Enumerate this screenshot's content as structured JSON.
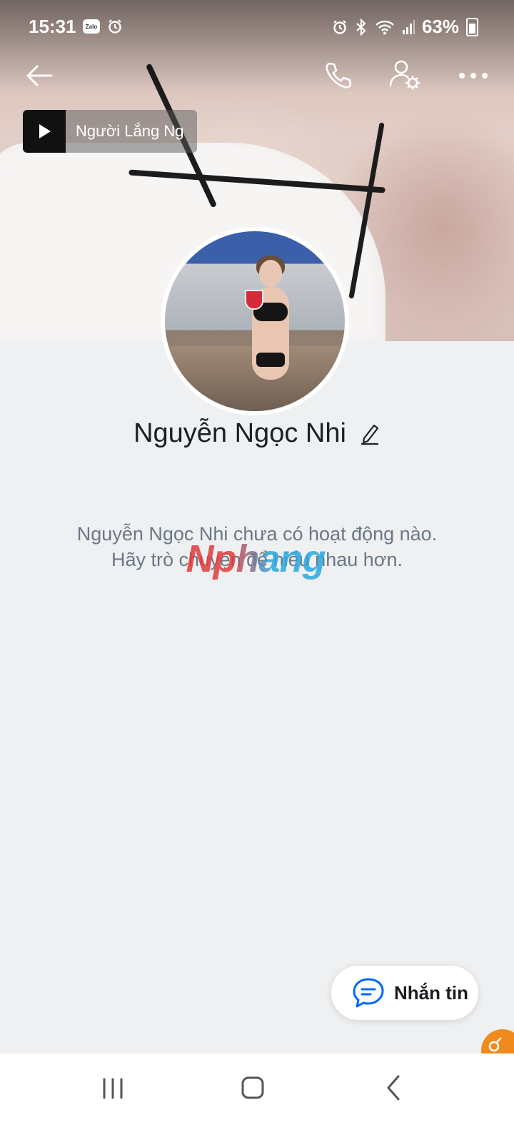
{
  "status_bar": {
    "time": "15:31",
    "zalo_badge": "Zalo",
    "battery_percent": "63%",
    "icons": [
      "zalo-icon",
      "alarm-icon",
      "alarm-icon",
      "bluetooth-icon",
      "wifi-icon",
      "signal-icon",
      "battery-icon"
    ]
  },
  "top_bar": {
    "icons": [
      "back-arrow-icon",
      "phone-icon",
      "user-settings-icon",
      "more-icon"
    ]
  },
  "music": {
    "title": "Người Lắng Ng"
  },
  "profile": {
    "name": "Nguyễn Ngọc Nhi"
  },
  "empty_state": {
    "line1": "Nguyễn Ngọc Nhi chưa có hoạt động nào.",
    "line2": "Hãy trò chuyện để hiểu nhau hơn."
  },
  "watermark": "Nphang",
  "message_button": {
    "label": "Nhắn tin",
    "icon": "chat-bubble-icon"
  },
  "colors": {
    "accent": "#0068ff",
    "background": "#eef0f2",
    "muted_text": "#6c7886",
    "corner_badge": "#f08a1c"
  },
  "nav_bar": {
    "icons": [
      "recents-icon",
      "home-icon",
      "back-icon"
    ]
  }
}
